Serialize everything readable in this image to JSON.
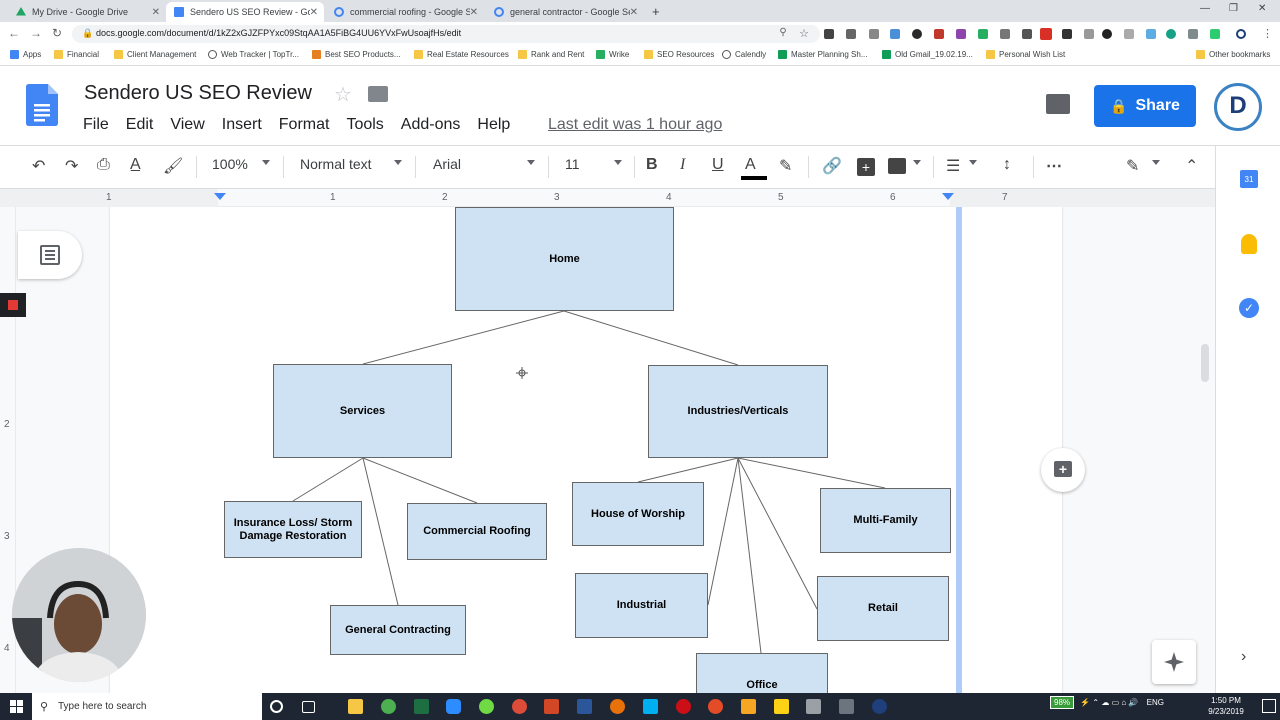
{
  "browser": {
    "tabs": [
      {
        "label": "My Drive - Google Drive",
        "color": "#1fa463"
      },
      {
        "label": "Sendero US SEO Review - Googl",
        "color": "#4285f4",
        "active": true
      },
      {
        "label": "commercial roofing - Google Sea",
        "color": "#4285f4"
      },
      {
        "label": "general contractor - Google Sea",
        "color": "#4285f4"
      }
    ],
    "url": "docs.google.com/document/d/1kZ2xGJZFPYxc09StqAA1A5FiBG4UU6YVxFwUsoajfHs/edit",
    "bookmarks": [
      "Apps",
      "Financial",
      "Client Management",
      "Web Tracker | TopTr...",
      "Best SEO Products...",
      "Real Estate Resources",
      "Rank and Rent",
      "Wrike",
      "SEO Resources",
      "Calendly",
      "Master Planning Sh...",
      "Old Gmail_19.02.19...",
      "Personal Wish List"
    ],
    "other_bookmarks": "Other bookmarks"
  },
  "doc": {
    "title": "Sendero US SEO Review",
    "menus": [
      "File",
      "Edit",
      "View",
      "Insert",
      "Format",
      "Tools",
      "Add-ons",
      "Help"
    ],
    "last_edit": "Last edit was 1 hour ago",
    "share_label": "Share",
    "avatar_letter": "D"
  },
  "toolbar": {
    "zoom": "100%",
    "style": "Normal text",
    "font": "Arial",
    "size": "11",
    "bold": "B",
    "italic": "I",
    "underline": "U",
    "text_color": "A"
  },
  "ruler": {
    "marks": [
      "1",
      "1",
      "2",
      "3",
      "4",
      "5",
      "6",
      "7"
    ]
  },
  "vruler": {
    "marks": [
      "2",
      "3",
      "4"
    ]
  },
  "diagram": {
    "nodes": {
      "home": "Home",
      "services": "Services",
      "industries": "Industries/Verticals",
      "insurance": "Insurance Loss/ Storm Damage Restoration",
      "roofing": "Commercial Roofing",
      "contracting": "General Contracting",
      "worship": "House of Worship",
      "multifamily": "Multi-Family",
      "industrial": "Industrial",
      "retail": "Retail",
      "office": "Office"
    }
  },
  "sidepanel": {
    "calendar_label": "31"
  },
  "taskbar": {
    "search_placeholder": "Type here to search",
    "battery": "98%",
    "lang": "ENG",
    "time": "1:50 PM",
    "date": "9/23/2019"
  }
}
